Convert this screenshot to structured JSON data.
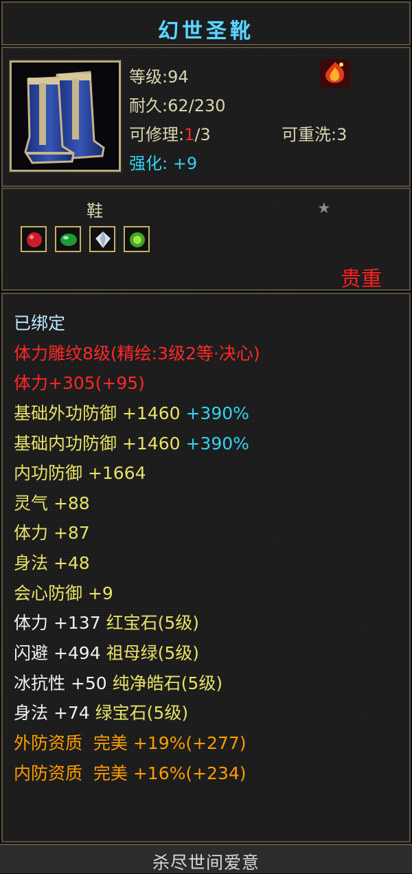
{
  "title": "幻世圣靴",
  "header": {
    "level_label": "等级",
    "level_value": ":94",
    "durability_label": "耐久",
    "durability_value": ":62/230",
    "repair_label": "可修理",
    "repair_colon": ":",
    "repair_used": "1",
    "repair_total": "/3",
    "rewash_label": "可重洗",
    "rewash_value": ":3",
    "enhance_label": "强化:",
    "enhance_value": "+9",
    "item_icon": "blue-boots-icon",
    "badge_icon": "red-fire-gem-icon"
  },
  "mid": {
    "item_type": "鞋",
    "star_icon": "star-icon",
    "gem_slots": [
      "red-gem-icon",
      "green-gem-icon",
      "white-diamond-icon",
      "green-gem-icon"
    ],
    "rarity": "贵重"
  },
  "attrs": [
    {
      "text": "已绑定",
      "color": "#bfeaff"
    },
    {
      "text": "体力雕纹8级(精绘:3级2等·决心)",
      "color": "#ff2828"
    },
    {
      "text": "体力+305(+95)",
      "color": "#ff2828"
    },
    {
      "text": "基础外功防御 +1460",
      "extra": "+390%",
      "color": "#e8e266"
    },
    {
      "text": "基础内功防御 +1460",
      "extra": "+390%",
      "color": "#e8e266"
    },
    {
      "text": "内功防御 +1664",
      "color": "#e8e266"
    },
    {
      "text": "灵气 +88",
      "color": "#e8e266"
    },
    {
      "text": "体力 +87",
      "color": "#e8e266"
    },
    {
      "text": "身法 +48",
      "color": "#e8e266"
    },
    {
      "text": "会心防御 +9",
      "color": "#e8e266"
    },
    {
      "text": "体力 +137",
      "gem": "红宝石(5级)",
      "color": "#f2f2f2"
    },
    {
      "text": "闪避 +494",
      "gem": "祖母绿(5级)",
      "color": "#f2f2f2"
    },
    {
      "text": "冰抗性 +50",
      "gem": "纯净皓石(5级)",
      "color": "#f2f2f2"
    },
    {
      "text": "身法 +74",
      "gem": "绿宝石(5级)",
      "color": "#f2f2f2"
    },
    {
      "text": "外防资质  完美 +19%(+277)",
      "color": "#ff9d00"
    },
    {
      "text": "内防资质  完美 +16%(+234)",
      "color": "#ff9d00"
    }
  ],
  "footer": "杀尽世间爱意"
}
